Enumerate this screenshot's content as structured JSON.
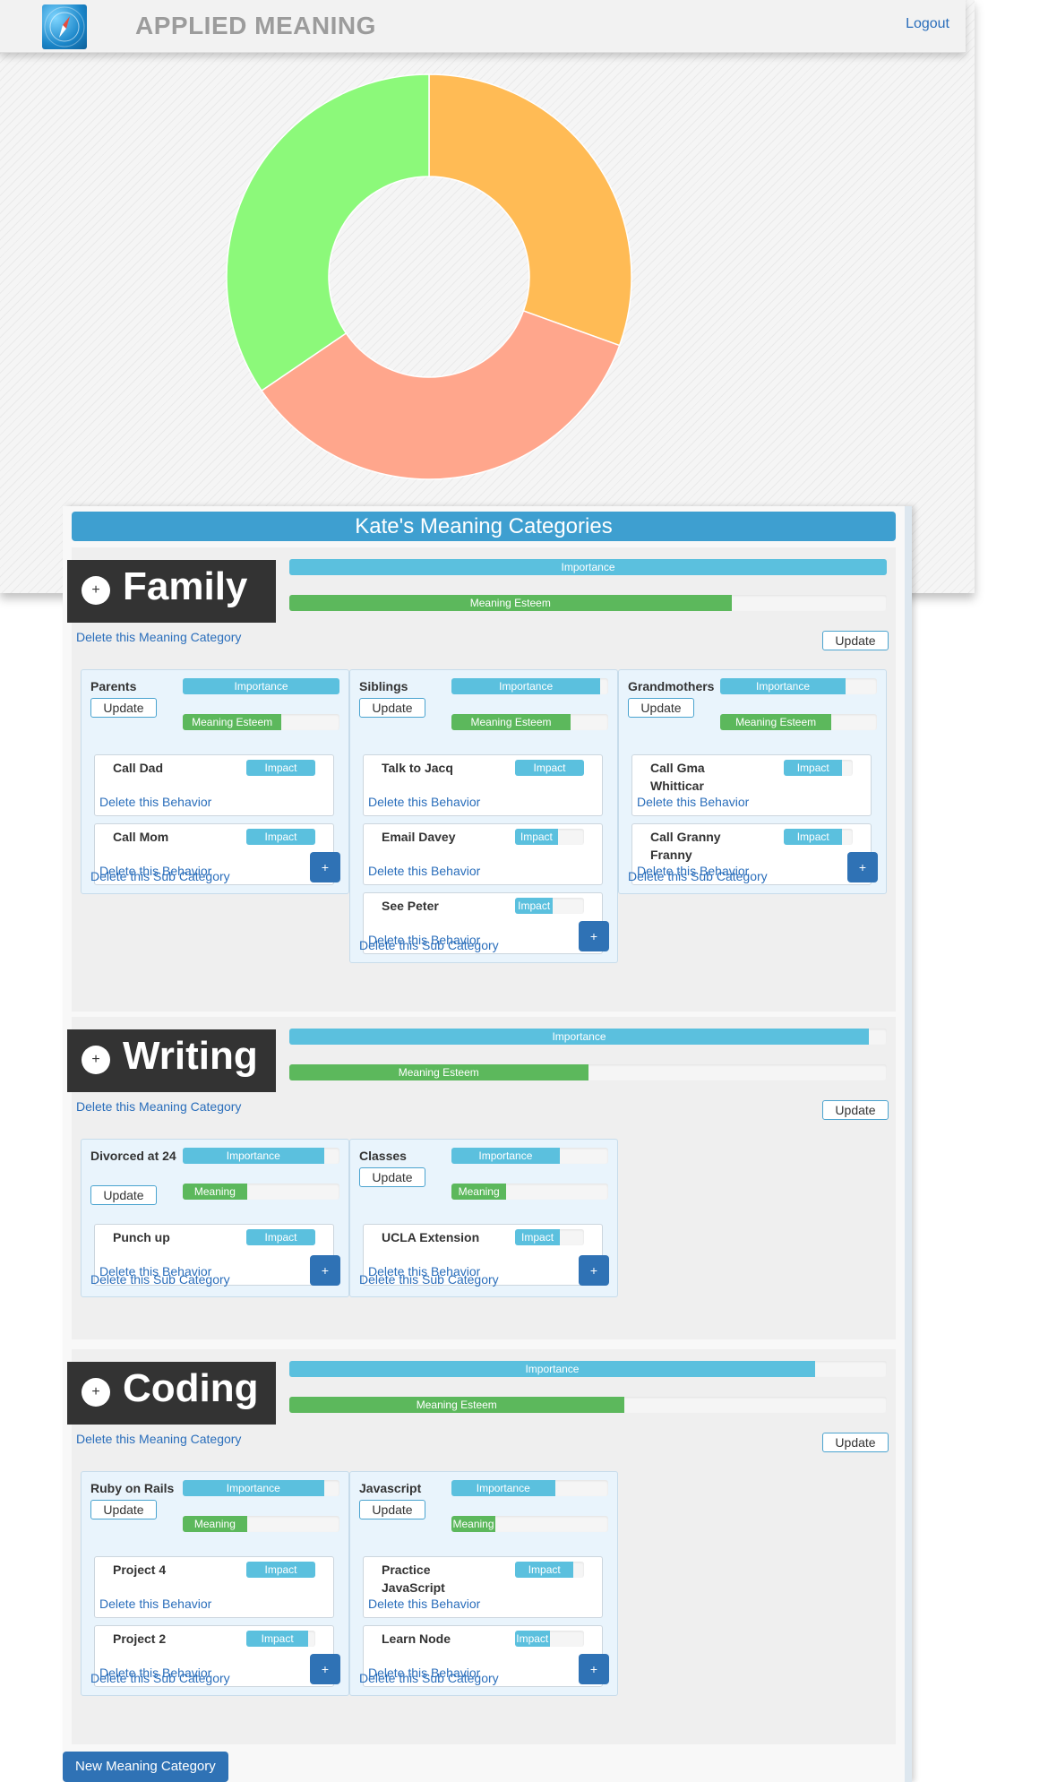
{
  "app": {
    "brand": "APPLIED MEANING",
    "logout_label": "Logout"
  },
  "donut": {
    "colors": [
      "#ffbb55",
      "#ffa68c",
      "#8cf97a"
    ],
    "values": [
      0.305,
      0.35,
      0.345
    ]
  },
  "page_title": "Kate's Meaning Categories",
  "labels": {
    "importance": "Importance",
    "meaning_esteem": "Meaning Esteem",
    "meaning": "Meaning",
    "impact": "Impact",
    "update": "Update",
    "delete_category": "Delete this Meaning Category",
    "delete_sub": "Delete this Sub Category",
    "delete_behavior": "Delete this Behavior",
    "plus": "+",
    "new_category": "New Meaning Category"
  },
  "categories": [
    {
      "name": "Family",
      "importance": 1.0,
      "esteem": 0.74,
      "subs": [
        {
          "name": "Parents",
          "importance": 1.0,
          "esteem": 0.63,
          "esteem_label": "Meaning Esteem",
          "behaviors": [
            {
              "name": "Call Dad",
              "impact": 1.0
            },
            {
              "name": "Call Mom",
              "impact": 1.0
            }
          ]
        },
        {
          "name": "Siblings",
          "importance": 0.95,
          "esteem": 0.76,
          "esteem_label": "Meaning Esteem",
          "behaviors": [
            {
              "name": "Talk to Jacq",
              "impact": 1.0
            },
            {
              "name": "Email Davey",
              "impact": 0.62
            },
            {
              "name": "See Peter",
              "impact": 0.55
            }
          ]
        },
        {
          "name": "Grandmothers",
          "importance": 0.8,
          "esteem": 0.71,
          "esteem_label": "Meaning Esteem",
          "behaviors": [
            {
              "name": "Call Gma Whitticar",
              "impact": 0.85
            },
            {
              "name": "Call Granny Franny",
              "impact": 0.85
            }
          ]
        }
      ]
    },
    {
      "name": "Writing",
      "importance": 0.97,
      "esteem": 0.5,
      "subs": [
        {
          "name": "Divorced at 24",
          "importance": 0.9,
          "esteem": 0.41,
          "esteem_label": "Meaning",
          "behaviors": [
            {
              "name": "Punch up",
              "impact": 1.0
            }
          ]
        },
        {
          "name": "Classes",
          "importance": 0.69,
          "esteem": 0.35,
          "esteem_label": "Meaning",
          "behaviors": [
            {
              "name": "UCLA Extension",
              "impact": 0.65
            }
          ]
        }
      ]
    },
    {
      "name": "Coding",
      "importance": 0.88,
      "esteem": 0.56,
      "subs": [
        {
          "name": "Ruby on Rails",
          "importance": 0.9,
          "esteem": 0.41,
          "esteem_label": "Meaning",
          "behaviors": [
            {
              "name": "Project 4",
              "impact": 1.0
            },
            {
              "name": "Project 2",
              "impact": 0.9
            }
          ]
        },
        {
          "name": "Javascript",
          "importance": 0.66,
          "esteem": 0.28,
          "esteem_label": "Meaning",
          "behaviors": [
            {
              "name": "Practice JavaScript",
              "impact": 0.85
            },
            {
              "name": "Learn Node",
              "impact": 0.5
            }
          ]
        }
      ]
    }
  ]
}
